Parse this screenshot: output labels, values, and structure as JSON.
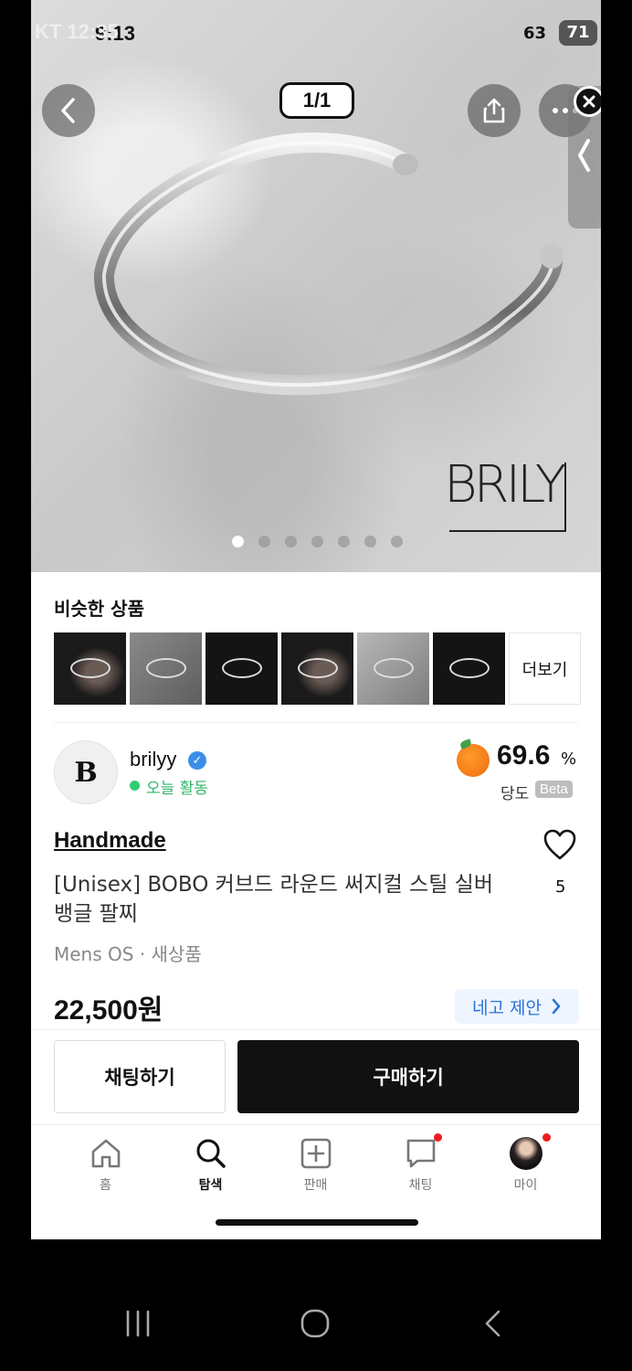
{
  "status_bar": {
    "carrier_time": "KT 12:35",
    "inner_time": "9:13",
    "inner_battery": "63",
    "battery": "71"
  },
  "gallery": {
    "counter": "1/1",
    "brand_mark": "BRILY",
    "dots": 7,
    "active_dot": 0
  },
  "similar": {
    "title": "비슷한 상품",
    "more_label": "더보기",
    "thumbs": [
      "dark",
      "gray",
      "black",
      "dark",
      "silver",
      "black"
    ]
  },
  "seller": {
    "avatar_letter": "B",
    "name": "brilyy",
    "status": "오늘 활동",
    "temperature": "69.6",
    "temperature_unit": "%",
    "temperature_label": "당도",
    "beta": "Beta"
  },
  "product": {
    "category": "Handmade",
    "title": "[Unisex] BOBO 커브드 라운드 써지컬 스틸 실버 뱅글 팔찌",
    "meta": "Mens OS · 새상품",
    "price": "22,500원",
    "likes": "5",
    "negotiate_label": "네고 제안"
  },
  "actions": {
    "chat": "채팅하기",
    "buy": "구매하기"
  },
  "nav": {
    "home": "홈",
    "search": "탐색",
    "sell": "판매",
    "chat": "채팅",
    "my": "마이"
  },
  "colors": {
    "accent_blue": "#2c74d8",
    "active_green": "#2eb467",
    "notification_red": "#ee1c1c"
  }
}
